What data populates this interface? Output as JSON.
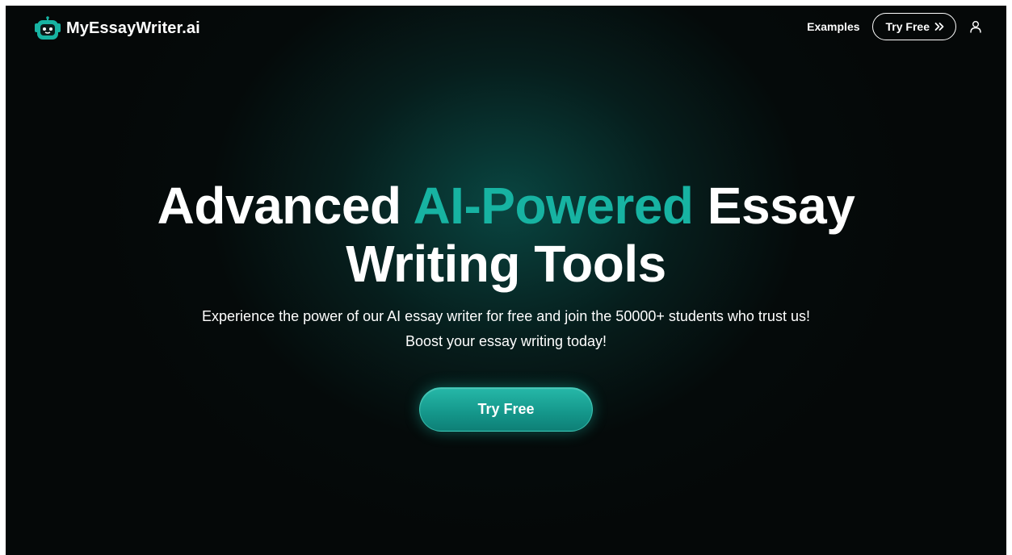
{
  "header": {
    "logo_text": "MyEssayWriter.ai",
    "logo_icon": "robot-face-icon",
    "nav": {
      "examples_label": "Examples",
      "try_free_label": "Try Free",
      "try_free_icon": "double-chevron-right-icon",
      "account_icon": "user-icon"
    }
  },
  "hero": {
    "title_part1": "Advanced ",
    "title_accent": "AI-Powered",
    "title_part2": " Essay",
    "title_line2": "Writing Tools",
    "subtitle_line1": "Experience the power of our AI essay writer for free and join the 50000+ students who trust us!",
    "subtitle_line2": "Boost your essay writing today!",
    "cta_label": "Try Free"
  },
  "colors": {
    "background": "#050808",
    "accent": "#17b3a2",
    "glow": "#0d7870",
    "text": "#ffffff"
  }
}
